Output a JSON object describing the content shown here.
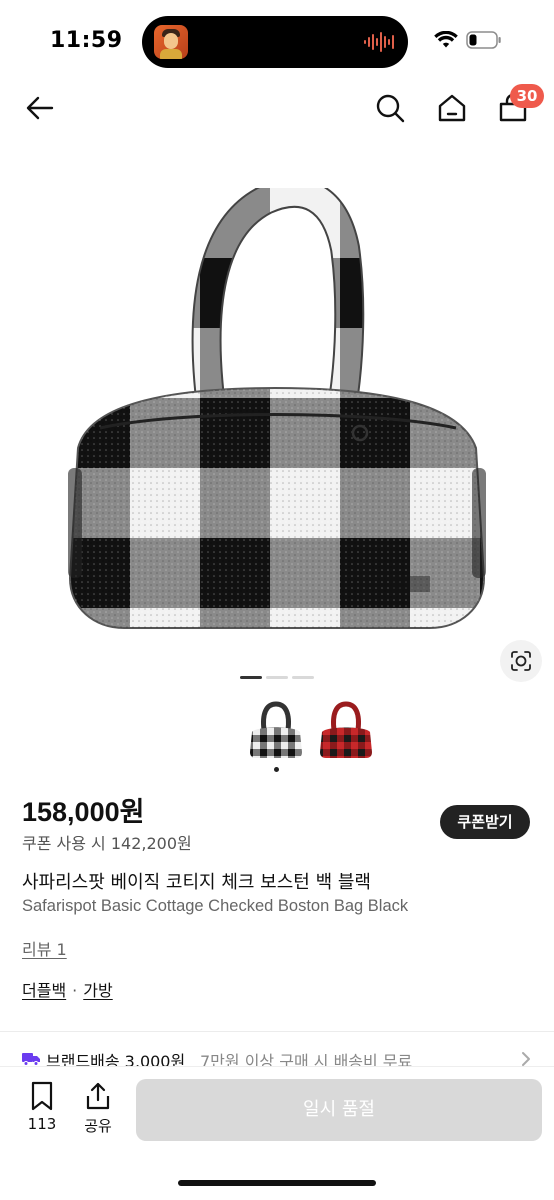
{
  "status_bar": {
    "time": "11:59"
  },
  "nav": {
    "cart_count": "30"
  },
  "product": {
    "price": "158,000원",
    "coupon_price": "쿠폰 사용 시 142,200원",
    "coupon_button": "쿠폰받기",
    "title": "사파리스팟 베이직 코티지 체크 보스턴 백 블랙",
    "subtitle": "Safarispot Basic Cottage Checked Boston Bag Black",
    "review_link": "리뷰 1",
    "categories": [
      "더플백",
      "가방"
    ],
    "category_separator": "·"
  },
  "gallery": {
    "page_count": 3,
    "active_page": 1,
    "variants": [
      {
        "color": "black-white check",
        "selected": true
      },
      {
        "color": "red-black check",
        "selected": false
      }
    ]
  },
  "shipping": {
    "label": "브랜드배송 3,000원",
    "note": "7만원 이상 구매 시 배송비 무료"
  },
  "bottom_bar": {
    "bookmark_count": "113",
    "share_label": "공유",
    "action_label": "일시 품절"
  },
  "colors": {
    "badge": "#ef5a4c",
    "coupon_button_bg": "#222222",
    "disabled_button": "#d9d9d9",
    "truck_icon": "#6b3cf0"
  }
}
